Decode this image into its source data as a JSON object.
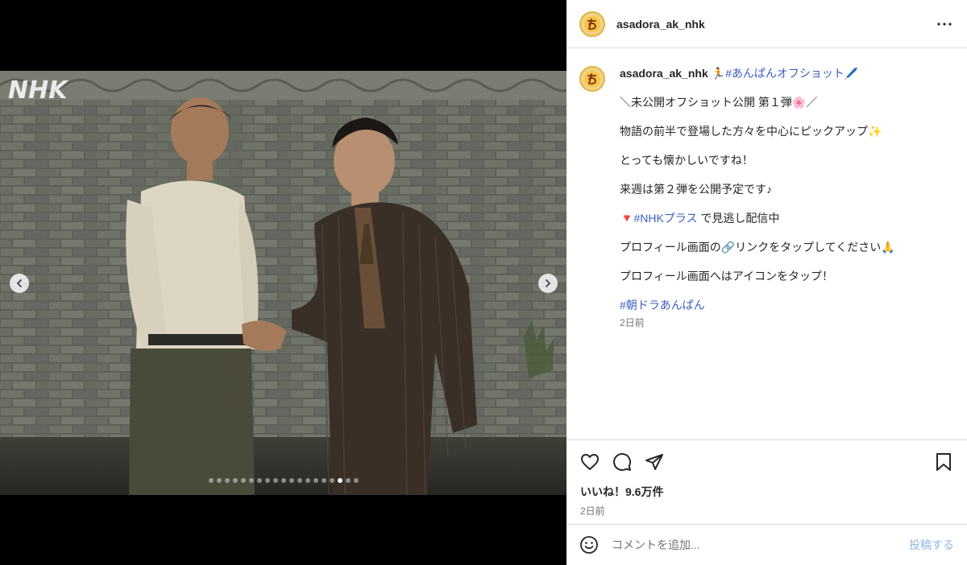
{
  "media": {
    "watermark": "NHK",
    "dot_count": 19,
    "active_dot": 16
  },
  "account": {
    "username": "asadora_ak_nhk"
  },
  "caption": {
    "username": "asadora_ak_nhk",
    "runner_emoji": "🏃",
    "hashtag_title": "#あんぱんオフショット",
    "pen_emoji": "🖊️",
    "line1": "＼未公開オフショット公開 第１弾🌸／",
    "line2": "物語の前半で登場した方々を中心にピックアップ✨",
    "line3": "とっても懐かしいですね！",
    "line4": "来週は第２弾を公開予定です♪",
    "line5_prefix": "🔻",
    "line5_hashtag": "#NHKプラス",
    "line5_text": " で見逃し配信中",
    "line6": "プロフィール画面の🔗リンクをタップしてください🙏",
    "line7": "プロフィール画面へはアイコンをタップ！",
    "hashtag2": "#朝ドラあんぱん",
    "time": "2日前"
  },
  "likes": "いいね！9.6万件",
  "post_time": "2日前",
  "comment": {
    "placeholder": "コメントを追加...",
    "post_label": "投稿する"
  },
  "colors": {
    "link": "#00376b",
    "border": "#dbdbdb",
    "muted": "#737373",
    "post_button": "#8fb7e6"
  }
}
